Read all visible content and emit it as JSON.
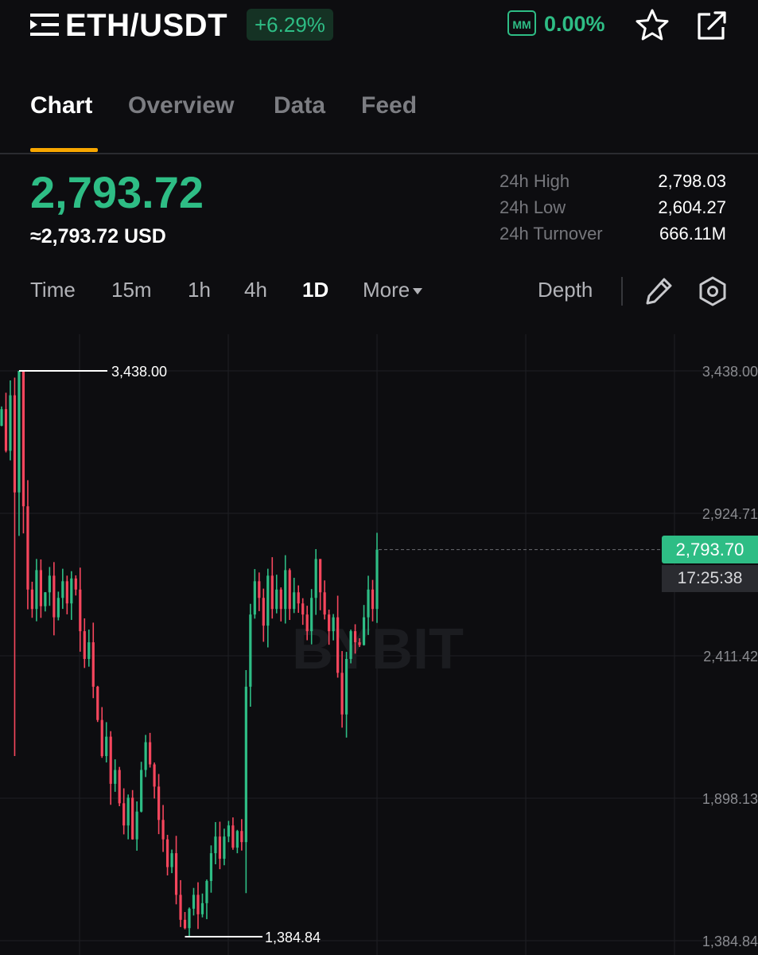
{
  "header": {
    "pair": "ETH/USDT",
    "change_pct": "+6.29%",
    "mm_label": "MM",
    "mm_value": "0.00%",
    "icons": [
      "menu-icon",
      "star-icon",
      "share-icon"
    ]
  },
  "tabs": [
    {
      "label": "Chart",
      "active": true
    },
    {
      "label": "Overview",
      "active": false
    },
    {
      "label": "Data",
      "active": false
    },
    {
      "label": "Feed",
      "active": false
    }
  ],
  "price": {
    "last": "2,793.72",
    "usd": "≈2,793.72 USD"
  },
  "stats": [
    {
      "label": "24h High",
      "value": "2,798.03"
    },
    {
      "label": "24h Low",
      "value": "2,604.27"
    },
    {
      "label": "24h Turnover",
      "value": "666.11M"
    }
  ],
  "timeframes": [
    {
      "label": "Time",
      "active": false
    },
    {
      "label": "15m",
      "active": false
    },
    {
      "label": "1h",
      "active": false
    },
    {
      "label": "4h",
      "active": false
    },
    {
      "label": "1D",
      "active": true
    },
    {
      "label": "More",
      "active": false
    }
  ],
  "toolbar": {
    "depth_label": "Depth",
    "icons": [
      "pencil-icon",
      "settings-icon"
    ]
  },
  "colors": {
    "up": "#2ebd85",
    "down": "#f6465d",
    "accent": "#f7a600",
    "background": "#0d0d10"
  },
  "chart_data": {
    "type": "candlestick",
    "interval": "1D",
    "y_ticks": [
      "3,438.00",
      "2,924.71",
      "2,411.42",
      "1,898.13",
      "1,384.84"
    ],
    "ylim": [
      1384.84,
      3438.0
    ],
    "high_marker": "3,438.00",
    "low_marker": "1,384.84",
    "last_price_tag": "2,793.70",
    "last_price_value": 2793.7,
    "countdown": "17:25:38",
    "watermark": "BYBIT",
    "grid": true,
    "close_path": [
      3300,
      3150,
      3350,
      3000,
      3438,
      2950,
      2650,
      2580,
      2720,
      2590,
      2640,
      2700,
      2550,
      2620,
      2680,
      2600,
      2690,
      2650,
      2500,
      2400,
      2460,
      2300,
      2180,
      2050,
      2120,
      1950,
      2000,
      1880,
      1800,
      1900,
      1750,
      1850,
      2000,
      2100,
      2020,
      1940,
      1820,
      1750,
      1650,
      1700,
      1550,
      1460,
      1430,
      1500,
      1550,
      1480,
      1520,
      1600,
      1700,
      1760,
      1680,
      1760,
      1800,
      1720,
      1780,
      1740,
      2300,
      2560,
      2680,
      2620,
      2520,
      2700,
      2580,
      2650,
      2580,
      2720,
      2580,
      2640,
      2600,
      2560,
      2500,
      2620,
      2760,
      2640,
      2560,
      2500,
      2550,
      2350,
      2200,
      2400,
      2500,
      2460,
      2450,
      2550,
      2650,
      2580,
      2793.7
    ]
  }
}
